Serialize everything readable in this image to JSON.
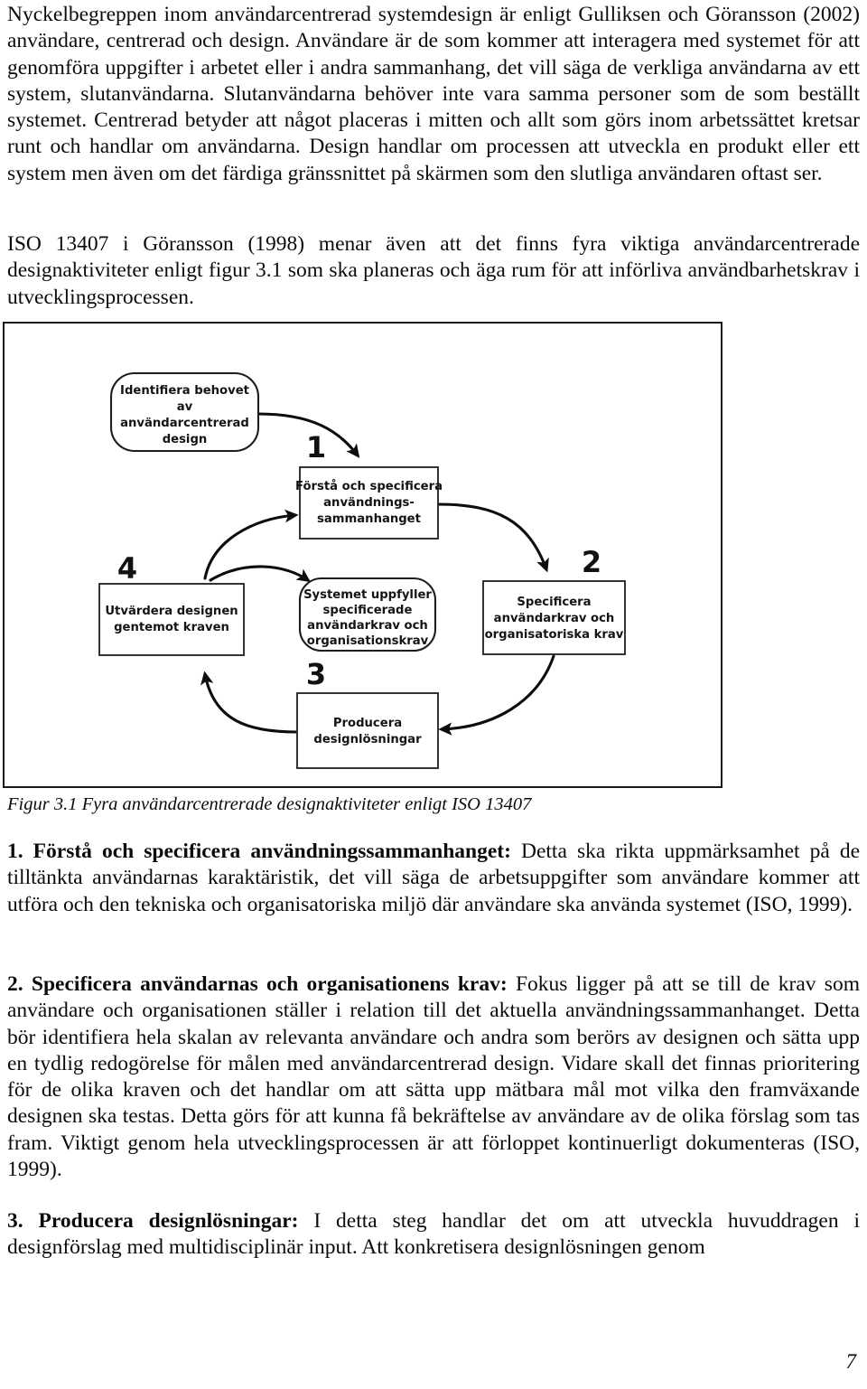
{
  "document": {
    "page_number": "7",
    "paragraphs": [
      {
        "id": "intro",
        "text": "Nyckelbegreppen inom användarcentrerad systemdesign är enligt Gulliksen och Göransson (2002) användare, centrerad och design. Användare är de som kommer att interagera med systemet för att genomföra uppgifter i arbetet eller i andra sammanhang, det vill säga de verkliga användarna av ett system, slutanvändarna. Slutanvändarna behöver inte vara samma personer som de som beställt systemet. Centrerad betyder att något placeras i mitten och allt som görs inom arbetssättet kretsar runt och handlar om användarna. Design handlar om processen att utveckla en produkt eller ett system men även om det färdiga gränssnittet på skärmen som den slutliga användaren oftast ser."
      },
      {
        "id": "iso-intro",
        "text": "ISO 13407 i Göransson (1998) menar även att det finns fyra viktiga användarcentrerade designaktiviteter enligt figur 3.1 som ska planeras och äga rum för att införliva användbarhetskrav i utvecklingsprocessen."
      }
    ],
    "figure": {
      "caption": "Figur 3.1 Fyra användarcentrerade designaktiviteter enligt ISO 13407",
      "nodes": [
        {
          "id": "identifiera",
          "shape": "rounded",
          "lines": [
            "Identifiera behovet",
            "av",
            "användarcentrerad",
            "design"
          ]
        },
        {
          "id": "forsta",
          "shape": "rect",
          "step": "1",
          "lines": [
            "Förstå och specificera",
            "användnings-",
            "sammanhanget"
          ]
        },
        {
          "id": "specificera",
          "shape": "rect",
          "step": "2",
          "lines": [
            "Specificera",
            "användarkrav och",
            "organisatoriska krav"
          ]
        },
        {
          "id": "producera",
          "shape": "rect",
          "step": "3",
          "lines": [
            "Producera",
            "designlösningar"
          ]
        },
        {
          "id": "utvardera",
          "shape": "rect",
          "step": "4",
          "lines": [
            "Utvärdera designen",
            "gentemot kraven"
          ]
        },
        {
          "id": "systemet",
          "shape": "rounded",
          "lines": [
            "Systemet uppfyller",
            "specificerade",
            "användarkrav och",
            "organisationskrav"
          ]
        }
      ],
      "step_labels": [
        "1",
        "2",
        "3",
        "4"
      ]
    },
    "sections": [
      {
        "id": "section-1",
        "heading": "1. Förstå och specificera användningssammanhanget:",
        "text": " Detta ska rikta uppmärksamhet på de tilltänkta användarnas karaktäristik, det vill säga de arbetsuppgifter som användare kommer att utföra och den tekniska och organisatoriska miljö där användare ska använda systemet (ISO, 1999)."
      },
      {
        "id": "section-2",
        "heading": "2. Specificera användarnas och organisationens krav:",
        "text": " Fokus ligger på att se till de krav som användare och organisationen ställer i relation till det aktuella användningssammanhanget. Detta bör identifiera hela skalan av relevanta användare och andra som berörs av designen och sätta upp en tydlig redogörelse för målen med användarcentrerad design. Vidare skall det finnas prioritering för de olika kraven och det handlar om att sätta upp mätbara mål mot vilka den framväxande designen ska testas. Detta görs för att kunna få bekräftelse av användare av de olika förslag som tas fram. Viktigt genom hela utvecklingsprocessen är att förloppet kontinuerligt dokumenteras (ISO, 1999)."
      },
      {
        "id": "section-3",
        "heading": "3. Producera designlösningar:",
        "text": " I detta steg handlar det om att utveckla huvuddragen i designförslag med multidisciplinär input. Att konkretisera designlösningen genom"
      }
    ]
  }
}
